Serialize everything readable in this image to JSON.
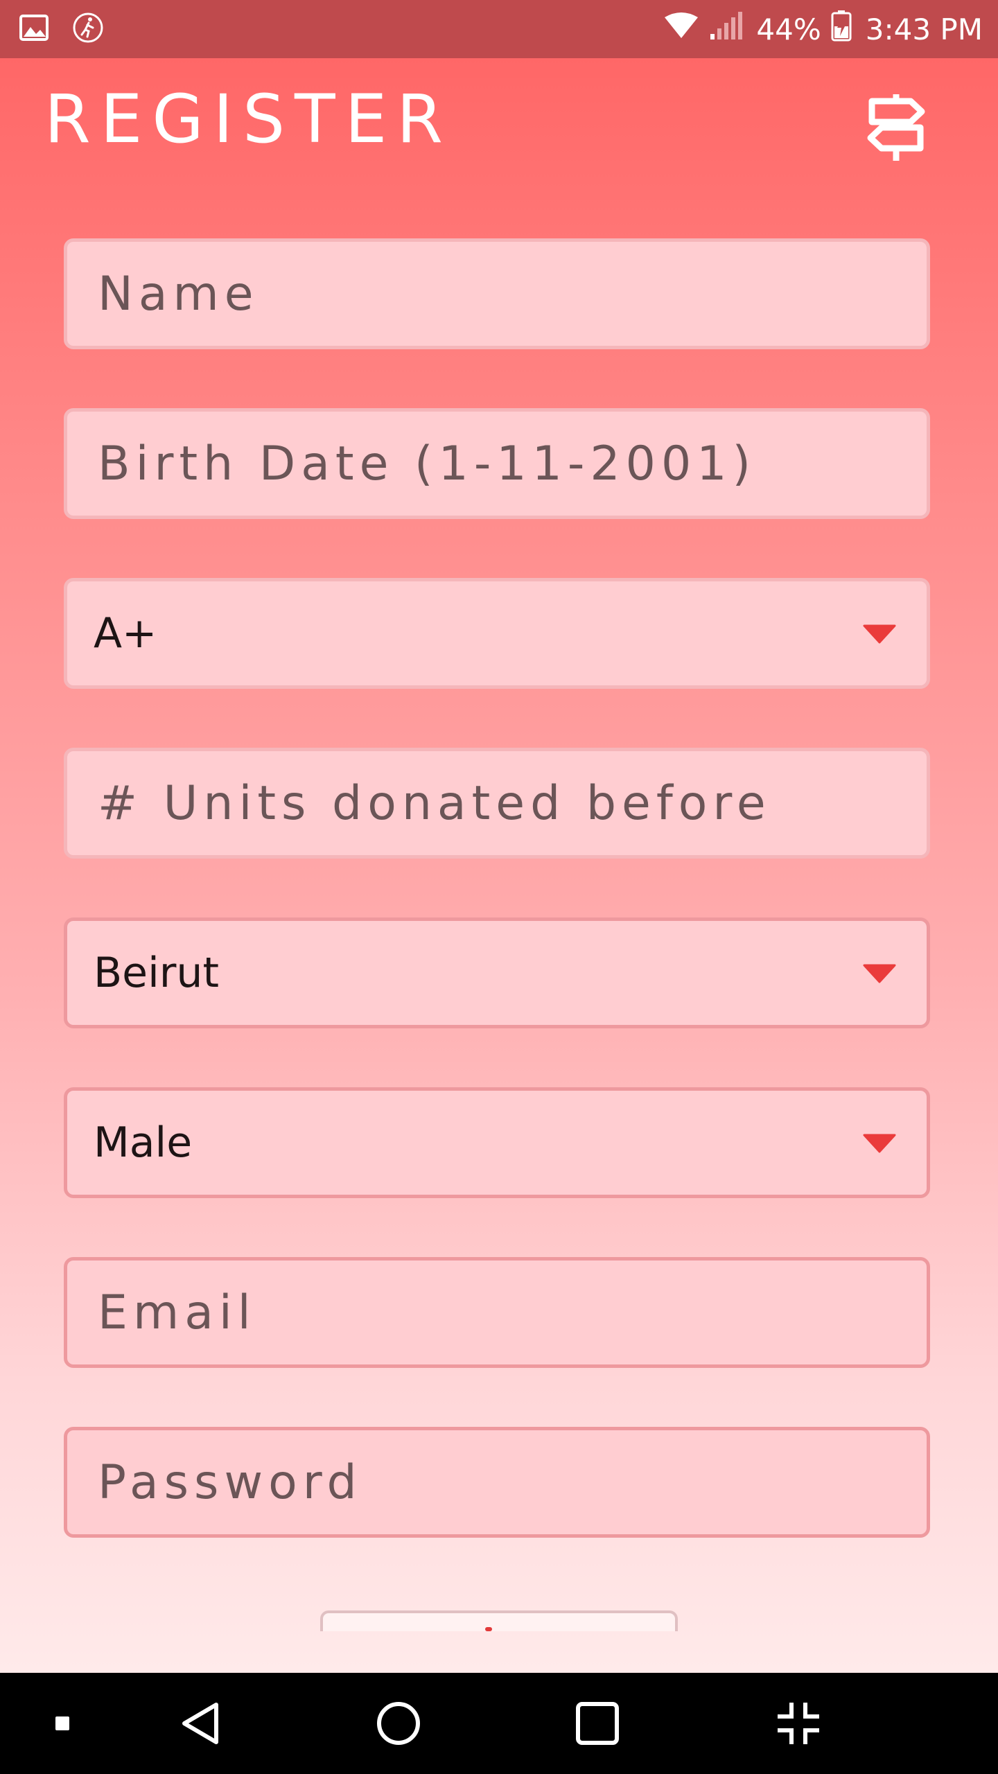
{
  "status_bar": {
    "icons": [
      "image-icon",
      "activity-icon",
      "wifi-icon",
      "signal-icon",
      "battery-charging-icon"
    ],
    "battery": "44%",
    "time": "3:43 PM"
  },
  "header": {
    "title": "REGISTER",
    "icon": "signpost-icon"
  },
  "form": {
    "name": {
      "placeholder": "Name"
    },
    "birth_date": {
      "placeholder": "Birth Date (1-11-2001)"
    },
    "blood_type": {
      "value": "A+"
    },
    "units_donated": {
      "placeholder": "# Units donated before"
    },
    "city": {
      "value": "Beirut"
    },
    "gender": {
      "value": "Male"
    },
    "email": {
      "placeholder": "Email"
    },
    "password": {
      "placeholder": "Password"
    }
  },
  "navigation": {
    "items": [
      "small-square-icon",
      "back-icon",
      "home-icon",
      "recents-icon",
      "collapse-icon"
    ]
  },
  "colors": {
    "status_bar": "#bf4a4d",
    "gradient_top": "#ff6767",
    "gradient_bottom": "#ffeaea",
    "field_background": "#ffcdd1",
    "dropdown_arrow": "#ea3b3b"
  }
}
